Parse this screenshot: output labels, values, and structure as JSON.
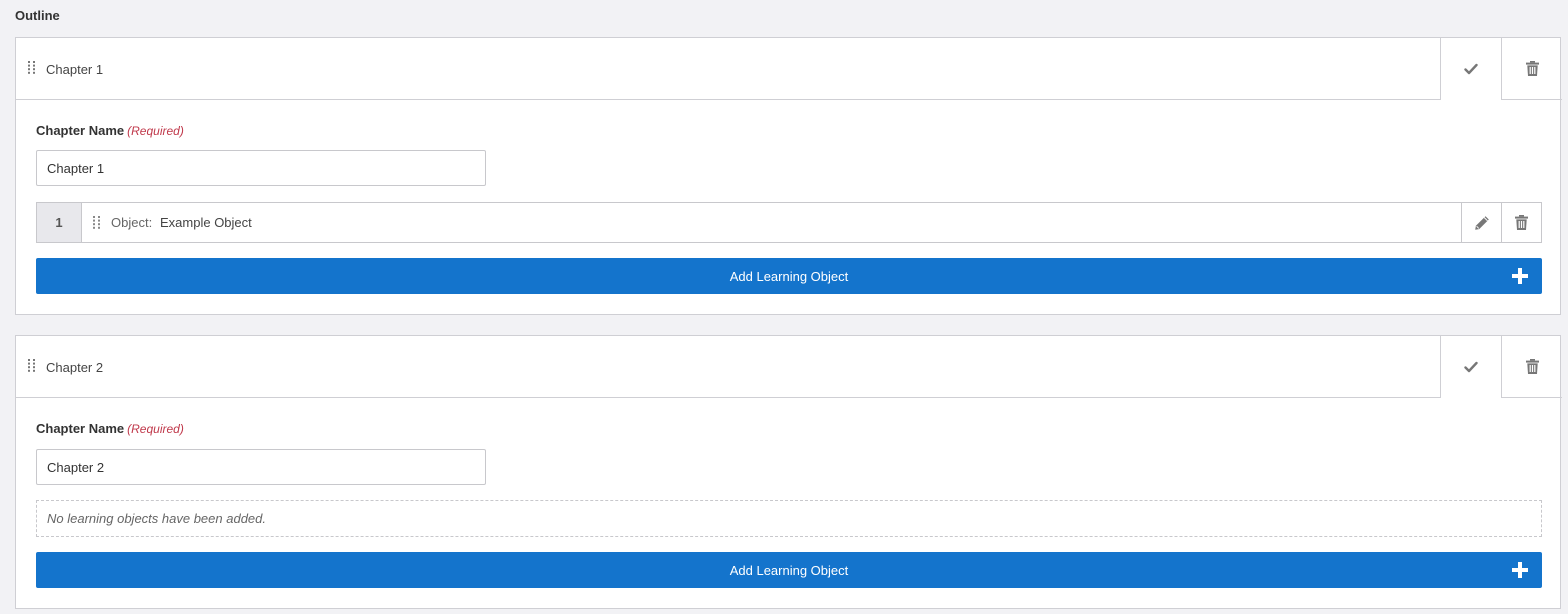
{
  "outline": {
    "title": "Outline"
  },
  "chapters": [
    {
      "header_title": "Chapter 1",
      "name_label": "Chapter Name",
      "required_label": "(Required)",
      "name_value": "Chapter 1",
      "objects": [
        {
          "number": "1",
          "label": "Object:",
          "name": "Example Object"
        }
      ],
      "add_button_label": "Add Learning Object"
    },
    {
      "header_title": "Chapter 2",
      "name_label": "Chapter Name",
      "required_label": "(Required)",
      "name_value": "Chapter 2",
      "empty_message": "No learning objects have been added.",
      "add_button_label": "Add Learning Object"
    }
  ],
  "icons": {
    "drag": "drag-handle-icon",
    "check": "check-icon",
    "trash": "trash-icon",
    "edit": "pencil-icon",
    "add": "plus-icon"
  },
  "colors": {
    "accent": "#1474cc",
    "required": "#c0394b",
    "background": "#f2f2f5",
    "border": "#cfcfd4"
  }
}
